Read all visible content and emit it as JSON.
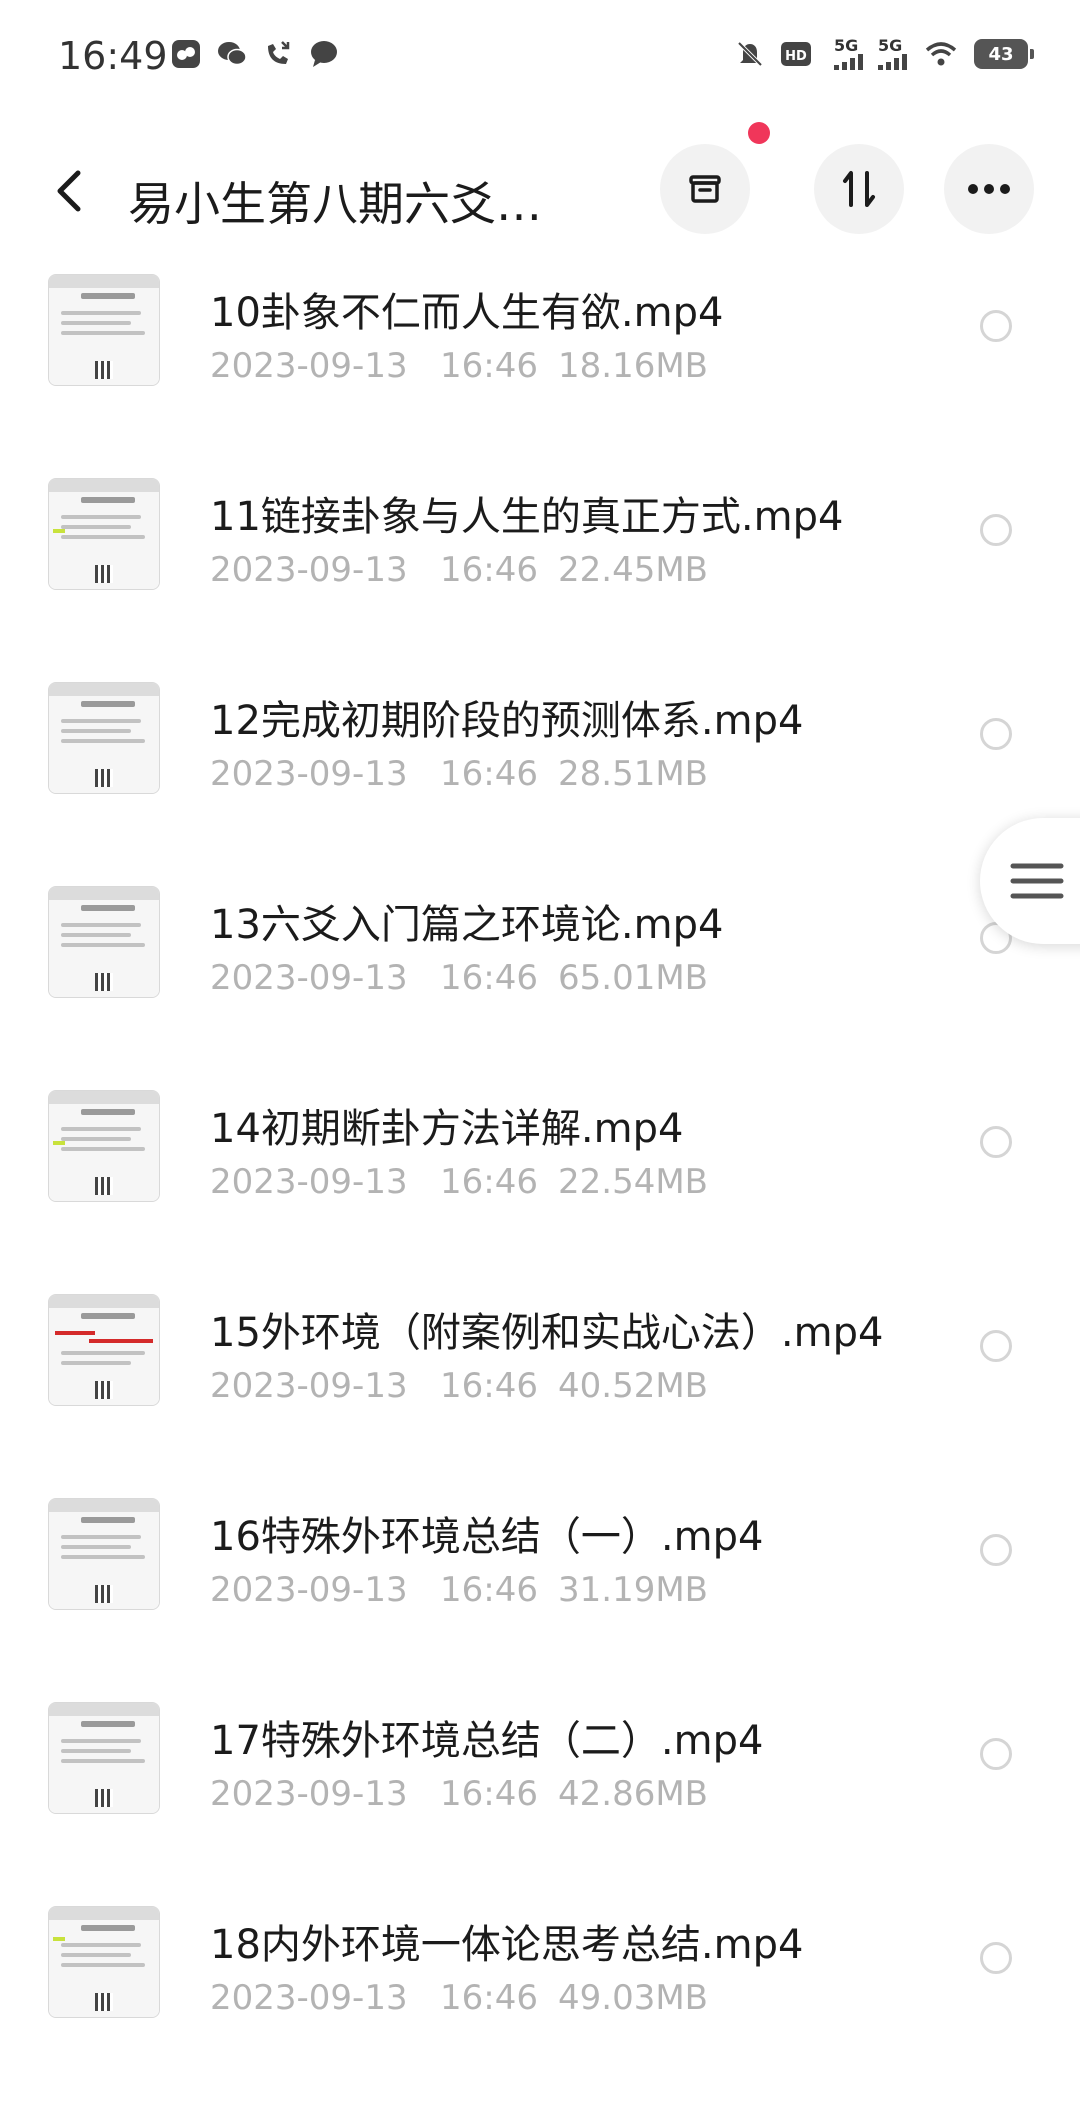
{
  "status_bar": {
    "time": "16:49",
    "signal1": "5G",
    "signal2": "5G",
    "battery": "43"
  },
  "header": {
    "title": "易小生第八期六爻…"
  },
  "files": [
    {
      "name": "10卦象不仁而人生有欲.mp4",
      "date": "2023-09-13",
      "time": "16:46",
      "size": "18.16MB"
    },
    {
      "name": "11链接卦象与人生的真正方式.mp4",
      "date": "2023-09-13",
      "time": "16:46",
      "size": "22.45MB"
    },
    {
      "name": "12完成初期阶段的预测体系.mp4",
      "date": "2023-09-13",
      "time": "16:46",
      "size": "28.51MB"
    },
    {
      "name": "13六爻入门篇之环境论.mp4",
      "date": "2023-09-13",
      "time": "16:46",
      "size": "65.01MB"
    },
    {
      "name": "14初期断卦方法详解.mp4",
      "date": "2023-09-13",
      "time": "16:46",
      "size": "22.54MB"
    },
    {
      "name": "15外环境（附案例和实战心法）.mp4",
      "date": "2023-09-13",
      "time": "16:46",
      "size": "40.52MB"
    },
    {
      "name": "16特殊外环境总结（一）.mp4",
      "date": "2023-09-13",
      "time": "16:46",
      "size": "31.19MB"
    },
    {
      "name": "17特殊外环境总结（二）.mp4",
      "date": "2023-09-13",
      "time": "16:46",
      "size": "42.86MB"
    },
    {
      "name": "18内外环境一体论思考总结.mp4",
      "date": "2023-09-13",
      "time": "16:46",
      "size": "49.03MB"
    }
  ],
  "colors": {
    "accent_dot": "#f0365a",
    "meta_text": "#b3b3b3"
  },
  "icons": {
    "back": "chevron-left-icon",
    "archive": "archive-icon",
    "sort": "sort-icon",
    "more": "more-icon",
    "handle": "menu-icon"
  }
}
